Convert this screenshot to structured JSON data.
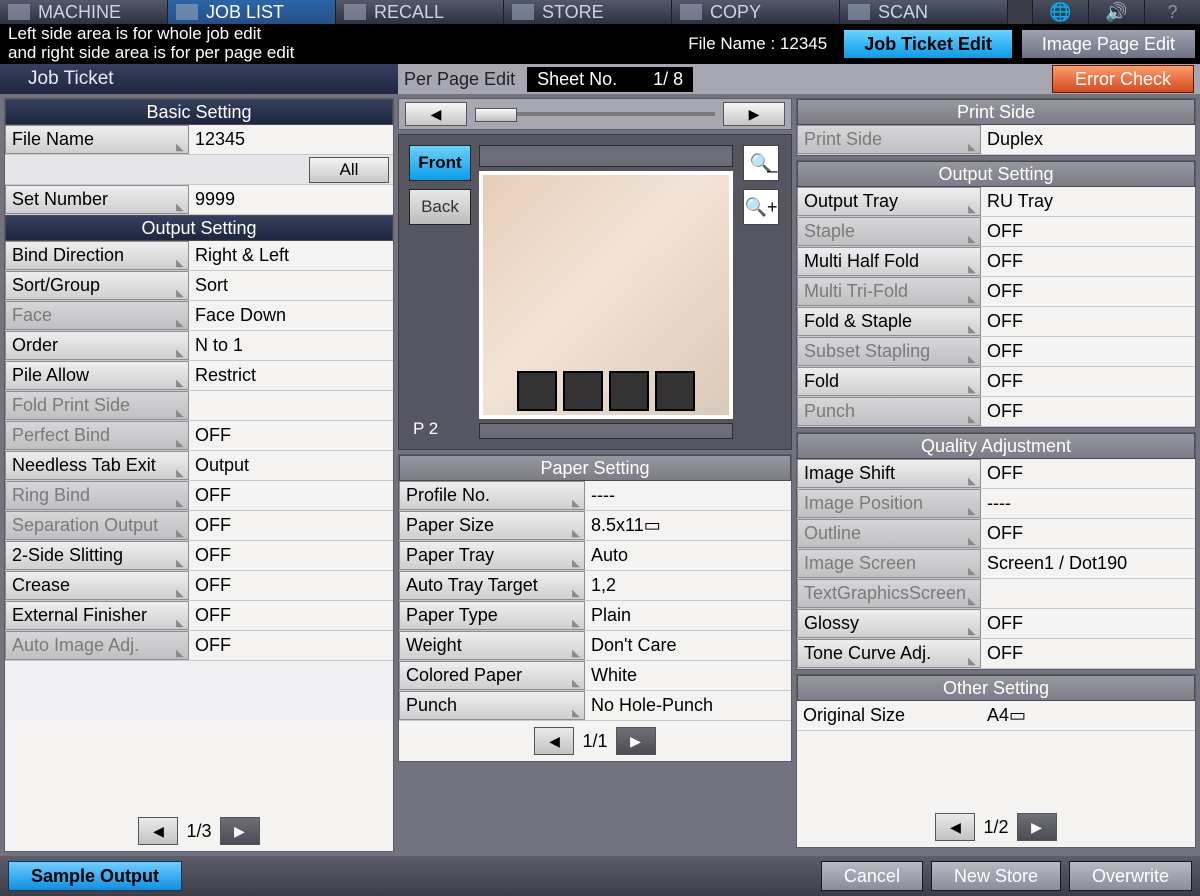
{
  "tabs": [
    "MACHINE",
    "JOB LIST",
    "RECALL",
    "STORE",
    "COPY",
    "SCAN"
  ],
  "active_tab": 1,
  "info_msg": "Left side area is for whole job edit\nand right side area is for per page edit",
  "file_name_label": "File Name :",
  "file_name_value": "12345",
  "mode_buttons": {
    "edit": "Job Ticket Edit",
    "image": "Image Page Edit"
  },
  "left_title": "Job Ticket",
  "right_title": "Per Page Edit",
  "sheet_no_label": "Sheet No.",
  "sheet_no_value": "1/    8",
  "error_btn": "Error Check",
  "basic": {
    "header": "Basic Setting",
    "rows": [
      {
        "label": "File Name",
        "value": "12345"
      },
      {
        "type": "all",
        "label": "All"
      },
      {
        "label": "Set Number",
        "value": "9999"
      }
    ]
  },
  "output_left": {
    "header": "Output Setting",
    "rows": [
      {
        "label": "Bind Direction",
        "value": "Right & Left"
      },
      {
        "label": "Sort/Group",
        "value": "Sort"
      },
      {
        "label": "Face",
        "value": "Face Down",
        "disabled": true
      },
      {
        "label": "Order",
        "value": "N to 1"
      },
      {
        "label": "Pile Allow",
        "value": "Restrict"
      },
      {
        "label": "Fold Print Side",
        "value": "",
        "disabled": true
      },
      {
        "label": "Perfect Bind",
        "value": "OFF",
        "disabled": true
      },
      {
        "label": "Needless Tab Exit",
        "value": "Output"
      },
      {
        "label": "Ring Bind",
        "value": "OFF",
        "disabled": true
      },
      {
        "label": "Separation Output",
        "value": "OFF",
        "disabled": true
      },
      {
        "label": "2-Side Slitting",
        "value": "OFF"
      },
      {
        "label": "Crease",
        "value": "OFF"
      },
      {
        "label": "External Finisher",
        "value": "OFF"
      },
      {
        "label": "Auto Image Adj.",
        "value": "OFF",
        "disabled": true
      }
    ]
  },
  "preview": {
    "front": "Front",
    "back": "Back",
    "pagenum": "P   2"
  },
  "paper": {
    "header": "Paper Setting",
    "rows": [
      {
        "label": "Profile No.",
        "value": "----"
      },
      {
        "label": "Paper Size",
        "value": " 8.5x11▭"
      },
      {
        "label": "Paper Tray",
        "value": "Auto"
      },
      {
        "label": "Auto Tray Target",
        "value": "1,2"
      },
      {
        "label": "Paper Type",
        "value": "Plain"
      },
      {
        "label": "Weight",
        "value": "Don't Care"
      },
      {
        "label": "Colored Paper",
        "value": "White"
      },
      {
        "label": "Punch",
        "value": "No Hole-Punch"
      }
    ]
  },
  "print_side": {
    "header": "Print Side",
    "rows": [
      {
        "label": "Print Side",
        "value": "Duplex",
        "disabled": true
      }
    ]
  },
  "output_right": {
    "header": "Output Setting",
    "rows": [
      {
        "label": "Output Tray",
        "value": "RU Tray"
      },
      {
        "label": "Staple",
        "value": "OFF",
        "disabled": true
      },
      {
        "label": "Multi Half Fold",
        "value": "OFF"
      },
      {
        "label": "Multi Tri-Fold",
        "value": "OFF",
        "disabled": true
      },
      {
        "label": "Fold & Staple",
        "value": "OFF"
      },
      {
        "label": "Subset Stapling",
        "value": "OFF",
        "disabled": true
      },
      {
        "label": "Fold",
        "value": "OFF"
      },
      {
        "label": "Punch",
        "value": "OFF",
        "disabled": true
      }
    ]
  },
  "quality": {
    "header": "Quality Adjustment",
    "rows": [
      {
        "label": "Image Shift",
        "value": "OFF"
      },
      {
        "label": "Image Position",
        "value": "----",
        "disabled": true
      },
      {
        "label": "Outline",
        "value": "OFF",
        "disabled": true
      },
      {
        "label": "Image Screen",
        "value": "Screen1 / Dot190",
        "disabled": true
      },
      {
        "label": "TextGraphicsScreen",
        "value": "",
        "disabled": true
      },
      {
        "label": "Glossy",
        "value": "OFF"
      },
      {
        "label": "Tone Curve Adj.",
        "value": "OFF"
      }
    ]
  },
  "other": {
    "header": "Other Setting",
    "rows": [
      {
        "label": "Original Size",
        "value": "A4▭",
        "plain": true
      }
    ]
  },
  "pagers": {
    "left": "1/3",
    "mid": "1/1",
    "right": "1/2"
  },
  "footer": {
    "sample": "Sample Output",
    "cancel": "Cancel",
    "newstore": "New Store",
    "overwrite": "Overwrite"
  }
}
